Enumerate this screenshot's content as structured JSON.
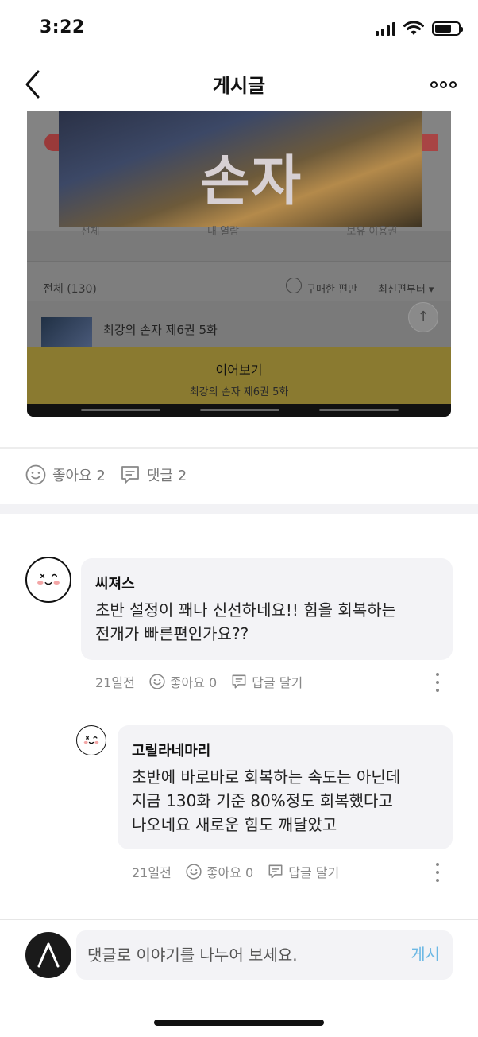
{
  "status": {
    "time": "3:22"
  },
  "nav": {
    "title": "게시글"
  },
  "post_image": {
    "cover_title": "손자",
    "tabs": [
      "전체",
      "내 열람",
      "보유 이용권"
    ],
    "list_total": "전체 (130)",
    "filter_label": "구매한 편만",
    "sort_label": "최신편부터 ▾",
    "episode_title": "최강의 손자 제6권 5화",
    "continue_label": "이어보기",
    "continue_sub": "최강의 손자 제6권 5화"
  },
  "reactions": {
    "like_label": "좋아요 2",
    "comment_label": "댓글 2"
  },
  "comments": [
    {
      "author": "씨져스",
      "text_line1": "초반 설정이 꽤나 신선하네요!! 힘을 회복하는",
      "text_line2": "전개가 빠른편인가요??",
      "time": "21일전",
      "like_label": "좋아요 0",
      "reply_label": "답글 달기"
    },
    {
      "author": "고릴라네마리",
      "text_line1": "초반에 바로바로 회복하는 속도는 아닌데",
      "text_line2": "지금 130화 기준 80%정도 회복했다고",
      "text_line3": "나오네요 새로운 힘도 깨달았고",
      "time": "21일전",
      "like_label": "좋아요 0",
      "reply_label": "답글 달기"
    }
  ],
  "composer": {
    "placeholder": "댓글로 이야기를 나누어 보세요.",
    "post_label": "게시"
  },
  "colors": {
    "accent": "#6cb8e4",
    "bubble": "#f3f3f6",
    "meta": "#888888"
  },
  "icons": [
    "back-icon",
    "more-icon",
    "smile-icon",
    "comment-icon",
    "kebab-icon",
    "scroll-top-icon"
  ]
}
